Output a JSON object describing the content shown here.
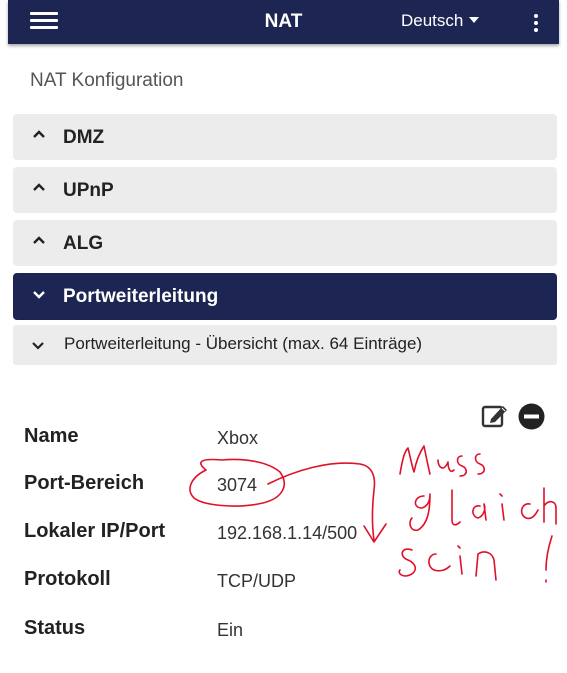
{
  "header": {
    "title": "NAT",
    "language": "Deutsch",
    "menu_icon": "hamburger-menu-icon",
    "more_icon": "vertical-dots-icon",
    "background": "#1d2652"
  },
  "page": {
    "title": "NAT Konfiguration"
  },
  "sections": [
    {
      "label": "DMZ",
      "icon": "chevron-up-icon",
      "expanded": false
    },
    {
      "label": "UPnP",
      "icon": "chevron-up-icon",
      "expanded": false
    },
    {
      "label": "ALG",
      "icon": "chevron-up-icon",
      "expanded": false
    },
    {
      "label": "Portweiterleitung",
      "icon": "chevron-down-icon",
      "expanded": true
    }
  ],
  "overview": {
    "label": "Portweiterleitung - Übersicht (max. 64 Einträge)",
    "icon": "chevron-down-icon"
  },
  "entry": {
    "edit_icon": "edit-icon",
    "remove_icon": "remove-circle-icon",
    "fields": [
      {
        "label": "Name",
        "value": "Xbox"
      },
      {
        "label": "Port-Bereich",
        "value": "3074"
      },
      {
        "label": "Lokaler IP/Port",
        "value": "192.168.1.14/500"
      },
      {
        "label": "Protokoll",
        "value": "TCP/UDP"
      },
      {
        "label": "Status",
        "value": "Ein"
      }
    ]
  },
  "annotation": {
    "color": "#e0102a",
    "lines": [
      "Muss",
      "gleich",
      "sein!"
    ]
  }
}
